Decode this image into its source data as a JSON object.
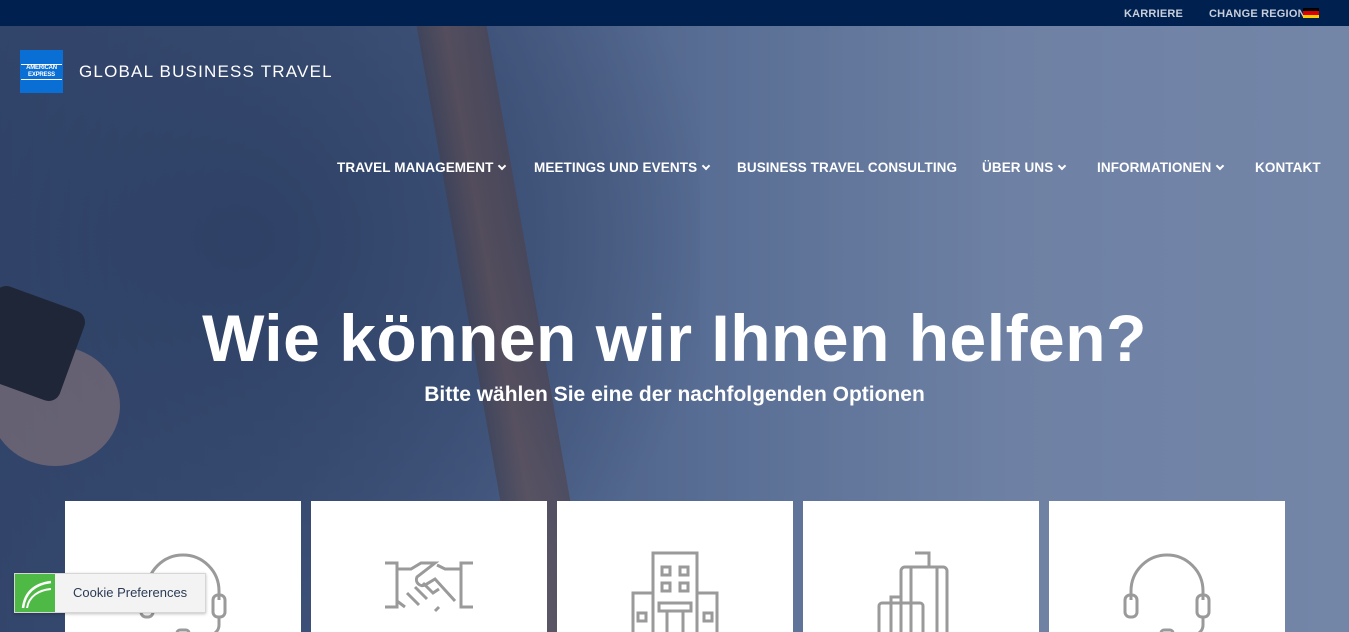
{
  "topbar": {
    "karriere": "KARRIERE",
    "change_region": "CHANGE REGION",
    "flag_colors": [
      "#000000",
      "#dd0000",
      "#ffce00"
    ]
  },
  "logo": {
    "badge_line1": "AMERICAN",
    "badge_line2": "EXPRESS",
    "text": "GLOBAL BUSINESS TRAVEL",
    "badge_color": "#0a6fd4"
  },
  "nav": {
    "items": [
      {
        "label": "TRAVEL MANAGEMENT",
        "has_dropdown": true
      },
      {
        "label": "MEETINGS UND EVENTS",
        "has_dropdown": true
      },
      {
        "label": "BUSINESS TRAVEL CONSULTING",
        "has_dropdown": false
      },
      {
        "label": "ÜBER UNS",
        "has_dropdown": true
      },
      {
        "label": "INFORMATIONEN",
        "has_dropdown": true
      },
      {
        "label": "KONTAKT",
        "has_dropdown": false
      }
    ]
  },
  "hero": {
    "headline": "Wie können wir Ihnen helfen?",
    "subheadline": "Bitte wählen Sie eine der nachfolgenden Optionen"
  },
  "cards": [
    {
      "icon": "headset-icon"
    },
    {
      "icon": "handshake-icon"
    },
    {
      "icon": "building-icon"
    },
    {
      "icon": "luggage-icon"
    },
    {
      "icon": "headset-icon"
    }
  ],
  "cookie": {
    "label": "Cookie Preferences",
    "accent": "#4fb946"
  },
  "colors": {
    "topbar_bg": "#00214f",
    "icon_gray": "#9a9a9a"
  }
}
